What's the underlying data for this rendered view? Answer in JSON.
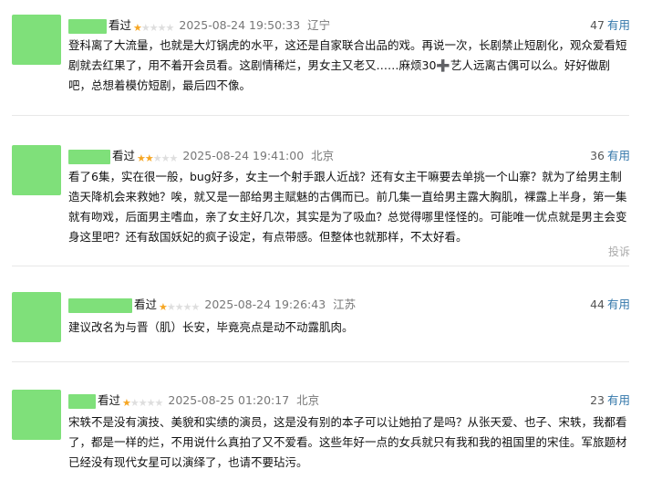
{
  "comments": [
    {
      "status": "看过",
      "stars": 1,
      "time": "2025-08-24 19:50:33",
      "location": "辽宁",
      "votes": "47",
      "useful_label": "有用",
      "text": "登科离了大流量，也就是大灯锅虎的水平，这还是自家联合出品的戏。再说一次，长剧禁止短剧化，观众爱看短剧就去红果了，用不着开会员看。这剧情稀烂，男女主又老又……麻烦30➕艺人远离古偶可以么。好好做剧吧，总想着模仿短剧，最后四不像。"
    },
    {
      "status": "看过",
      "stars": 2,
      "time": "2025-08-24 19:41:00",
      "location": "北京",
      "votes": "36",
      "useful_label": "有用",
      "text": "看了6集，实在很一般，bug好多，女主一个射手跟人近战？还有女主干嘛要去单挑一个山寨？就为了给男主制造天降机会来救她？唉，就又是一部给男主赋魅的古偶而已。前几集一直给男主露大胸肌，裸露上半身，第一集就有吻戏，后面男主嗜血，亲了女主好几次，其实是为了吸血？总觉得哪里怪怪的。可能唯一优点就是男主会变身这里吧？还有敌国妖妃的疯子设定，有点带感。但整体也就那样，不太好看。",
      "report_label": "投诉"
    },
    {
      "status": "看过",
      "stars": 1,
      "time": "2025-08-24 19:26:43",
      "location": "江苏",
      "votes": "44",
      "useful_label": "有用",
      "text": "建议改名为与晋（肌）长安，毕竟亮点是动不动露肌肉。"
    },
    {
      "status": "看过",
      "stars": 1,
      "time": "2025-08-25 01:20:17",
      "location": "北京",
      "votes": "23",
      "useful_label": "有用",
      "text": "宋轶不是没有演技、美貌和实绩的演员，这是没有别的本子可以让她拍了是吗？从张天爱、也子、宋轶，我都看了，都是一样的烂，不用说什么真拍了又不爱看。这些年好一点的女兵就只有我和我的祖国里的宋佳。军旅题材已经没有现代女星可以演绎了，也请不要玷污。"
    }
  ]
}
